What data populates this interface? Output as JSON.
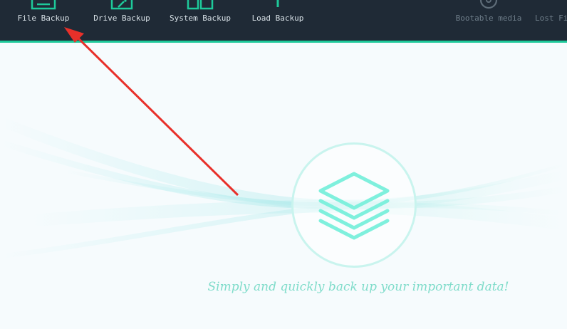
{
  "toolbar": {
    "items": [
      {
        "label": "File Backup",
        "icon": "file-backup-icon"
      },
      {
        "label": "Drive Backup",
        "icon": "drive-backup-icon"
      },
      {
        "label": "System Backup",
        "icon": "system-backup-icon"
      },
      {
        "label": "Load Backup",
        "icon": "load-backup-icon"
      },
      {
        "label": "Bootable media",
        "icon": "bootable-media-icon"
      },
      {
        "label": "Lost Fil",
        "icon": "lost-file-icon"
      }
    ],
    "colors": {
      "background": "#1f2a36",
      "accent": "#1ec99a",
      "label": "#d7e0e6",
      "label_dim": "#6e7d89"
    }
  },
  "main": {
    "hero_icon": "stacked-layers-icon",
    "tagline": "Simply and quickly back up your important data!",
    "colors": {
      "background": "#f6fbfd",
      "tagline": "#7fdcca",
      "hero": "#7ff0dd"
    }
  },
  "annotation": {
    "icon": "red-arrow-icon",
    "color": "#e8302a"
  }
}
